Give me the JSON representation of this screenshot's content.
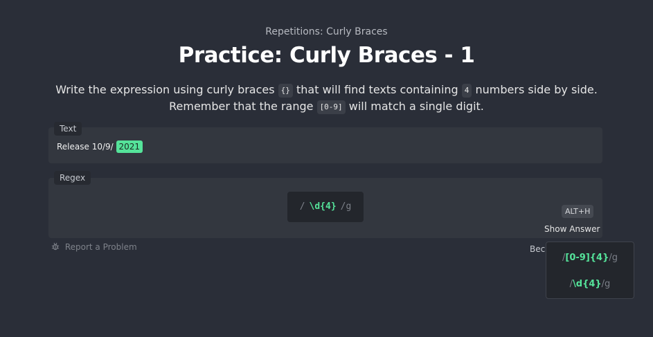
{
  "header": {
    "breadcrumb": "Repetitions: Curly Braces",
    "title": "Practice: Curly Braces - 1"
  },
  "description": {
    "part1": "Write the expression using curly braces ",
    "code1": "{}",
    "part2": " that will find texts containing ",
    "code2": "4",
    "part3": " numbers side by side.",
    "part4": "Remember that the range ",
    "code3": "[0-9]",
    "part5": " will match a single digit."
  },
  "text_panel": {
    "label": "Text",
    "prefix": "Release 10/9/ ",
    "match": "2021"
  },
  "regex_panel": {
    "label": "Regex",
    "open_slash": "/",
    "value": "\\d{4}",
    "flags": "/g",
    "shortcut": "ALT+H",
    "show_answer": "Show Answer"
  },
  "footer": {
    "report": "Report a Problem",
    "partial_text": "Bec"
  },
  "answers": [
    {
      "open": "/",
      "value": "[0-9]{4}",
      "flags": "/g"
    },
    {
      "open": "/",
      "value": "\\d{4}",
      "flags": "/g"
    }
  ],
  "colors": {
    "background": "#2a2e38",
    "panel": "#33373f",
    "accent_green": "#55e39a"
  }
}
